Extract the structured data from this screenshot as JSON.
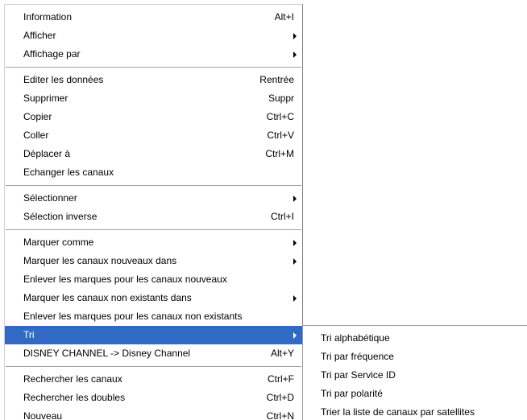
{
  "context_menu": {
    "groups": [
      [
        {
          "label": "Information",
          "shortcut": "Alt+I"
        },
        {
          "label": "Afficher",
          "submenu": true
        },
        {
          "label": "Affichage par",
          "submenu": true
        }
      ],
      [
        {
          "label": "Editer les données",
          "shortcut": "Rentrée"
        },
        {
          "label": "Supprimer",
          "shortcut": "Suppr"
        },
        {
          "label": "Copier",
          "shortcut": "Ctrl+C"
        },
        {
          "label": "Coller",
          "shortcut": "Ctrl+V"
        },
        {
          "label": "Déplacer à",
          "shortcut": "Ctrl+M"
        },
        {
          "label": "Echanger les canaux"
        }
      ],
      [
        {
          "label": "Sélectionner",
          "submenu": true
        },
        {
          "label": "Sélection inverse",
          "shortcut": "Ctrl+I"
        }
      ],
      [
        {
          "label": "Marquer comme",
          "submenu": true
        },
        {
          "label": "Marquer les canaux nouveaux dans",
          "submenu": true
        },
        {
          "label": "Enlever les marques pour les canaux nouveaux"
        },
        {
          "label": "Marquer les canaux non existants dans",
          "submenu": true
        },
        {
          "label": "Enlever les marques pour les canaux non existants"
        },
        {
          "label": "Tri",
          "submenu": true,
          "highlighted": true
        },
        {
          "label": "DISNEY CHANNEL -> Disney Channel",
          "shortcut": "Alt+Y"
        }
      ],
      [
        {
          "label": "Rechercher les canaux",
          "shortcut": "Ctrl+F"
        },
        {
          "label": "Rechercher les doubles",
          "shortcut": "Ctrl+D"
        },
        {
          "label": "Nouveau",
          "shortcut": "Ctrl+N"
        }
      ]
    ]
  },
  "tri_submenu": {
    "items": [
      {
        "label": "Tri alphabétique"
      },
      {
        "label": "Tri par fréquence"
      },
      {
        "label": "Tri par Service ID"
      },
      {
        "label": "Tri par polarité"
      },
      {
        "label": "Trier la liste de canaux par satellites"
      }
    ]
  },
  "colors": {
    "highlight": "#316ac5",
    "menu_background": "#ffffff",
    "separator": "#a0a0a0"
  }
}
